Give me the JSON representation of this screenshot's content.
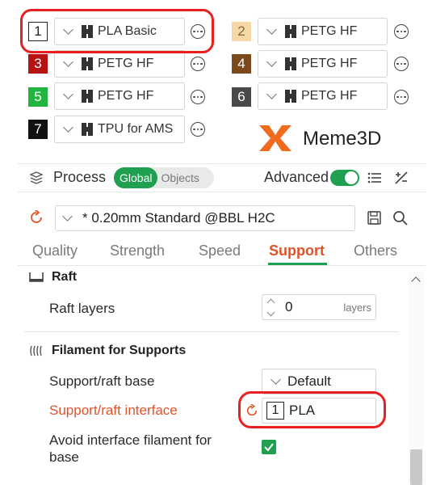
{
  "filaments": [
    {
      "slot": "1",
      "name": "PLA Basic",
      "color": "#ffffff",
      "text_color": "#222222"
    },
    {
      "slot": "2",
      "name": "PETG HF",
      "color": "#f6d7a7",
      "text_color": "#8a6a3a"
    },
    {
      "slot": "3",
      "name": "PETG HF",
      "color": "#b71313",
      "text_color": "#ffffff"
    },
    {
      "slot": "4",
      "name": "PETG HF",
      "color": "#7a4a1c",
      "text_color": "#ffffff"
    },
    {
      "slot": "5",
      "name": "PETG HF",
      "color": "#1fb53f",
      "text_color": "#ffffff"
    },
    {
      "slot": "6",
      "name": "PETG HF",
      "color": "#4a4a4a",
      "text_color": "#ffffff"
    },
    {
      "slot": "7",
      "name": "TPU for AMS",
      "color": "#111111",
      "text_color": "#ffffff"
    }
  ],
  "brand": {
    "name": "Meme3D",
    "accent": "#f26b1d"
  },
  "process": {
    "title": "Process",
    "seg_global": "Global",
    "seg_objects": "Objects",
    "advanced_label": "Advanced",
    "preset": "* 0.20mm Standard @BBL H2C"
  },
  "tabs": [
    "Quality",
    "Strength",
    "Speed",
    "Support",
    "Others"
  ],
  "active_tab": "Support",
  "raft": {
    "section": "Raft",
    "layers_label": "Raft layers",
    "layers_value": "0",
    "layers_unit": "layers"
  },
  "filament_supports": {
    "section": "Filament for Supports",
    "base_label": "Support/raft base",
    "base_value": "Default",
    "interface_label": "Support/raft interface",
    "interface_slot": "1",
    "interface_value": "PLA",
    "avoid_label_line1": "Avoid interface filament for",
    "avoid_label_line2": "base",
    "avoid_checked": true
  },
  "colors": {
    "green": "#1f9f50",
    "orange": "#e0522a",
    "highlight_red": "#e8201f"
  }
}
